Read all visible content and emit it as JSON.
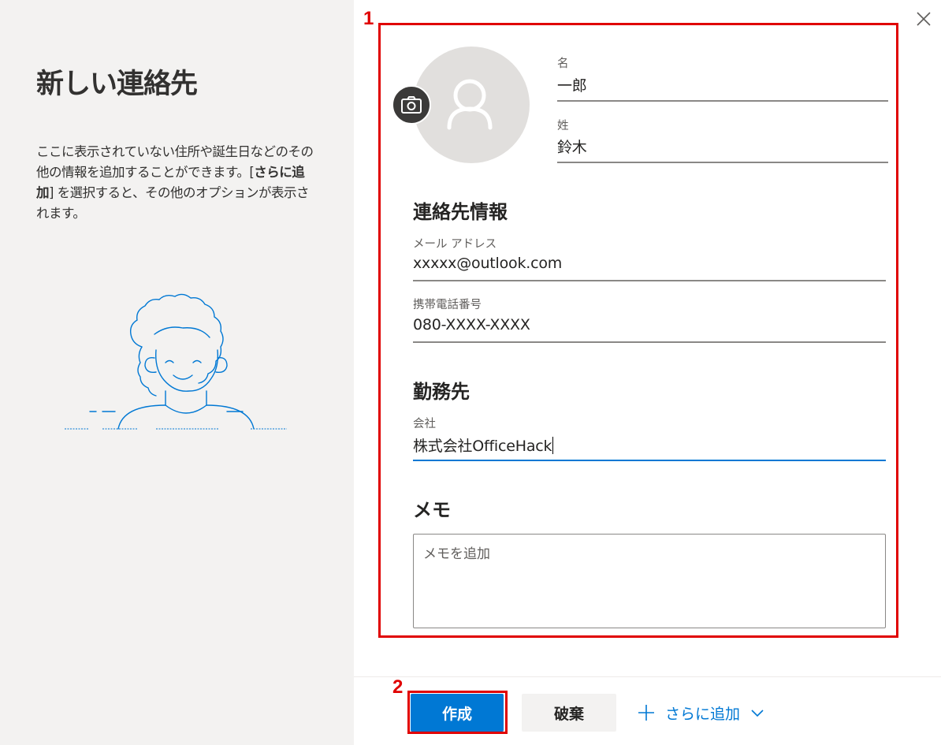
{
  "panel": {
    "title": "新しい連絡先",
    "description_parts": [
      "ここに表示されていない住所や誕生日などのその他の情報を追加することができます。[",
      "さらに追加",
      "] を選択すると、その他のオプションが表示されます。"
    ]
  },
  "annotations": {
    "box1": "1",
    "box2": "2"
  },
  "name": {
    "first_label": "名",
    "first_value": "一郎",
    "last_label": "姓",
    "last_value": "鈴木"
  },
  "contact_info": {
    "heading": "連絡先情報",
    "email_label": "メール アドレス",
    "email_value": "xxxxx@outlook.com",
    "phone_label": "携帯電話番号",
    "phone_value": "080-XXXX-XXXX"
  },
  "work": {
    "heading": "勤務先",
    "company_label": "会社",
    "company_value": "株式会社OfficeHack"
  },
  "memo": {
    "heading": "メモ",
    "placeholder": "メモを追加"
  },
  "actions": {
    "create": "作成",
    "discard": "破棄",
    "more": "さらに追加"
  },
  "colors": {
    "accent": "#0078d4",
    "annotation": "#e00000",
    "left_panel": "#f3f2f1",
    "avatar_bg": "#e1dfdd"
  },
  "icons": [
    "close-icon",
    "camera-icon",
    "person-icon",
    "plus-icon",
    "chevron-down-icon"
  ]
}
